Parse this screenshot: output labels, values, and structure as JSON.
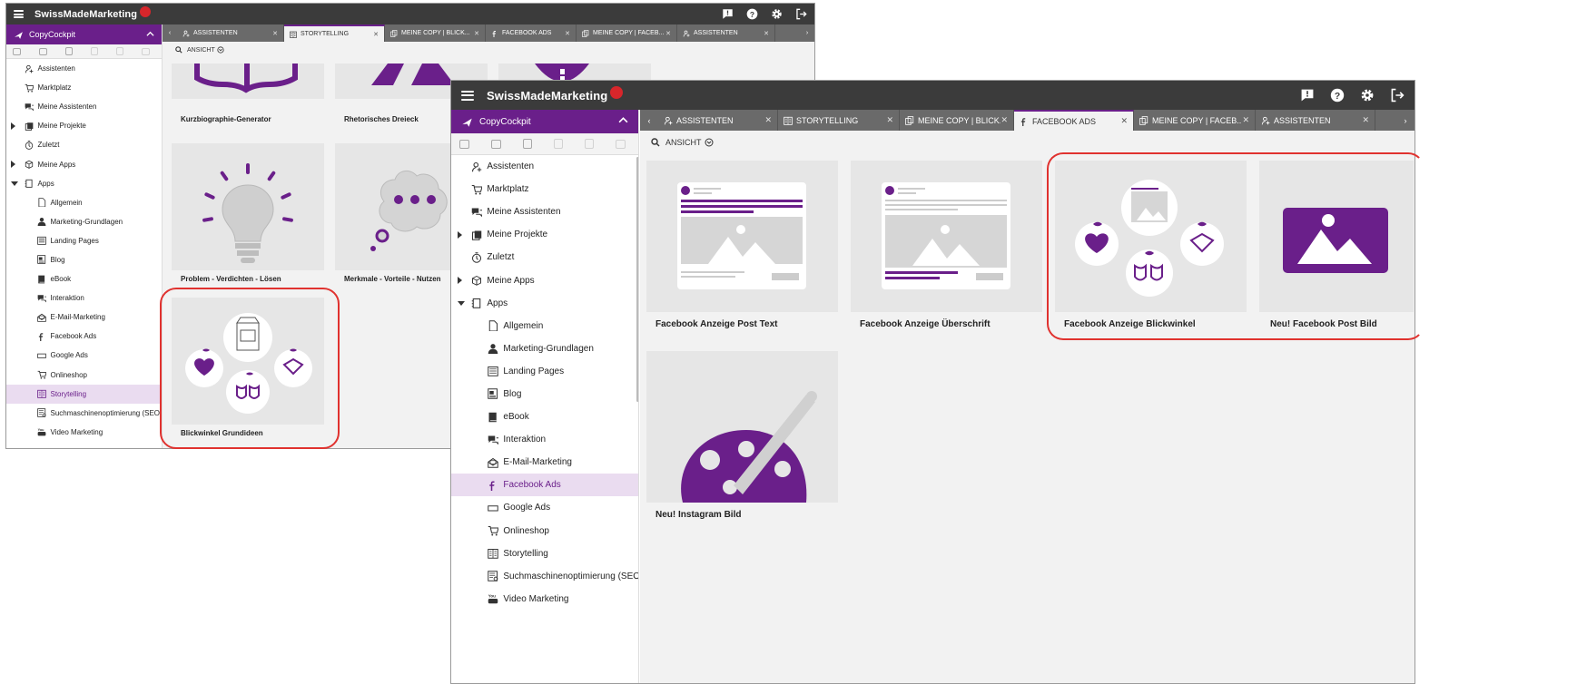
{
  "brand": "SwissMadeMarketing",
  "colors": {
    "accent": "#6a1f8a",
    "topbar": "#3b3b3b",
    "highlight": "#e0322f"
  },
  "sidebar": {
    "title": "CopyCockpit",
    "items": [
      {
        "label": "Assistenten",
        "icon": "user-assistant-icon"
      },
      {
        "label": "Marktplatz",
        "icon": "cart-icon"
      },
      {
        "label": "Meine Assistenten",
        "icon": "chat-icon"
      },
      {
        "label": "Meine Projekte",
        "icon": "folder-icon"
      },
      {
        "label": "Zuletzt",
        "icon": "clock-icon"
      },
      {
        "label": "Meine Apps",
        "icon": "cube-icon"
      },
      {
        "label": "Apps",
        "icon": "apps-icon"
      }
    ],
    "apps": [
      {
        "label": "Allgemein",
        "icon": "page-icon"
      },
      {
        "label": "Marketing-Grundlagen",
        "icon": "person-icon"
      },
      {
        "label": "Landing Pages",
        "icon": "landing-page-icon"
      },
      {
        "label": "Blog",
        "icon": "blog-icon"
      },
      {
        "label": "eBook",
        "icon": "book-icon"
      },
      {
        "label": "Interaktion",
        "icon": "chat-icon"
      },
      {
        "label": "E-Mail-Marketing",
        "icon": "mail-icon"
      },
      {
        "label": "Facebook Ads",
        "icon": "facebook-icon"
      },
      {
        "label": "Google Ads",
        "icon": "ad-icon"
      },
      {
        "label": "Onlineshop",
        "icon": "cart-icon"
      },
      {
        "label": "Storytelling",
        "icon": "story-icon"
      },
      {
        "label": "Suchmaschinenoptimierung (SEO)",
        "icon": "seo-icon"
      },
      {
        "label": "Video Marketing",
        "icon": "youtube-icon"
      }
    ]
  },
  "view_label": "ANSICHT",
  "back": {
    "active_app": "Storytelling",
    "tabs": [
      {
        "label": "ASSISTENTEN",
        "icon": "user-assistant-icon"
      },
      {
        "label": "STORYTELLING",
        "icon": "story-icon",
        "active": true
      },
      {
        "label": "MEINE COPY | BLICK...",
        "icon": "copy-icon"
      },
      {
        "label": "FACEBOOK ADS",
        "icon": "facebook-icon"
      },
      {
        "label": "MEINE COPY | FACEB...",
        "icon": "copy-icon"
      },
      {
        "label": "ASSISTENTEN",
        "icon": "user-assistant-icon"
      }
    ],
    "cards": [
      {
        "label": "Kurzbiographie-Generator"
      },
      {
        "label": "Rhetorisches Dreieck"
      },
      {
        "label": "Problem - Verdichten - Lösen"
      },
      {
        "label": "Merkmale - Vorteile - Nutzen"
      },
      {
        "label": "Blickwinkel Grundideen"
      }
    ]
  },
  "front": {
    "active_app": "Facebook Ads",
    "tabs": [
      {
        "label": "ASSISTENTEN",
        "icon": "user-assistant-icon"
      },
      {
        "label": "STORYTELLING",
        "icon": "story-icon"
      },
      {
        "label": "MEINE COPY | BLICK...",
        "icon": "copy-icon"
      },
      {
        "label": "FACEBOOK ADS",
        "icon": "facebook-icon",
        "active": true
      },
      {
        "label": "MEINE COPY | FACEB...",
        "icon": "copy-icon"
      },
      {
        "label": "ASSISTENTEN",
        "icon": "user-assistant-icon"
      }
    ],
    "cards": [
      {
        "label": "Facebook Anzeige Post Text"
      },
      {
        "label": "Facebook Anzeige Überschrift"
      },
      {
        "label": "Facebook Anzeige Blickwinkel"
      },
      {
        "label": "Neu! Facebook Post Bild"
      },
      {
        "label": "Neu! Instagram Bild"
      }
    ]
  }
}
